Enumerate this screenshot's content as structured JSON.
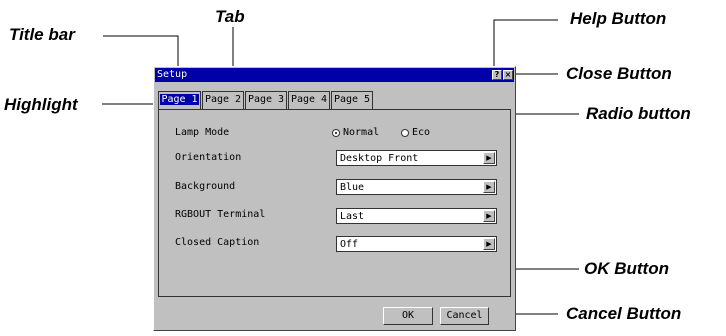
{
  "callouts": {
    "title_bar": "Title bar",
    "tab": "Tab",
    "highlight": "Highlight",
    "help_button": "Help Button",
    "close_button": "Close Button",
    "radio_button": "Radio button",
    "ok_button": "OK Button",
    "cancel_button": "Cancel Button"
  },
  "window": {
    "title": "Setup",
    "help_glyph": "?",
    "close_glyph": "×",
    "colors": {
      "titlebar": "#0000a8",
      "face": "#c0c0c0"
    }
  },
  "tabs": [
    {
      "label": "Page 1",
      "active": true
    },
    {
      "label": "Page 2",
      "active": false
    },
    {
      "label": "Page 3",
      "active": false
    },
    {
      "label": "Page 4",
      "active": false
    },
    {
      "label": "Page 5",
      "active": false
    }
  ],
  "settings": {
    "lamp_mode": {
      "label": "Lamp Mode",
      "options": [
        "Normal",
        "Eco"
      ],
      "selected": "Normal"
    },
    "orientation": {
      "label": "Orientation",
      "value": "Desktop Front"
    },
    "background": {
      "label": "Background",
      "value": "Blue"
    },
    "rgbout": {
      "label": "RGBOUT Terminal",
      "value": "Last"
    },
    "closed_caption": {
      "label": "Closed Caption",
      "value": "Off"
    }
  },
  "buttons": {
    "ok": "OK",
    "cancel": "Cancel"
  },
  "icons": {
    "dropdown_arrow": "chevron-right-icon",
    "help": "help-icon",
    "close": "close-icon"
  }
}
